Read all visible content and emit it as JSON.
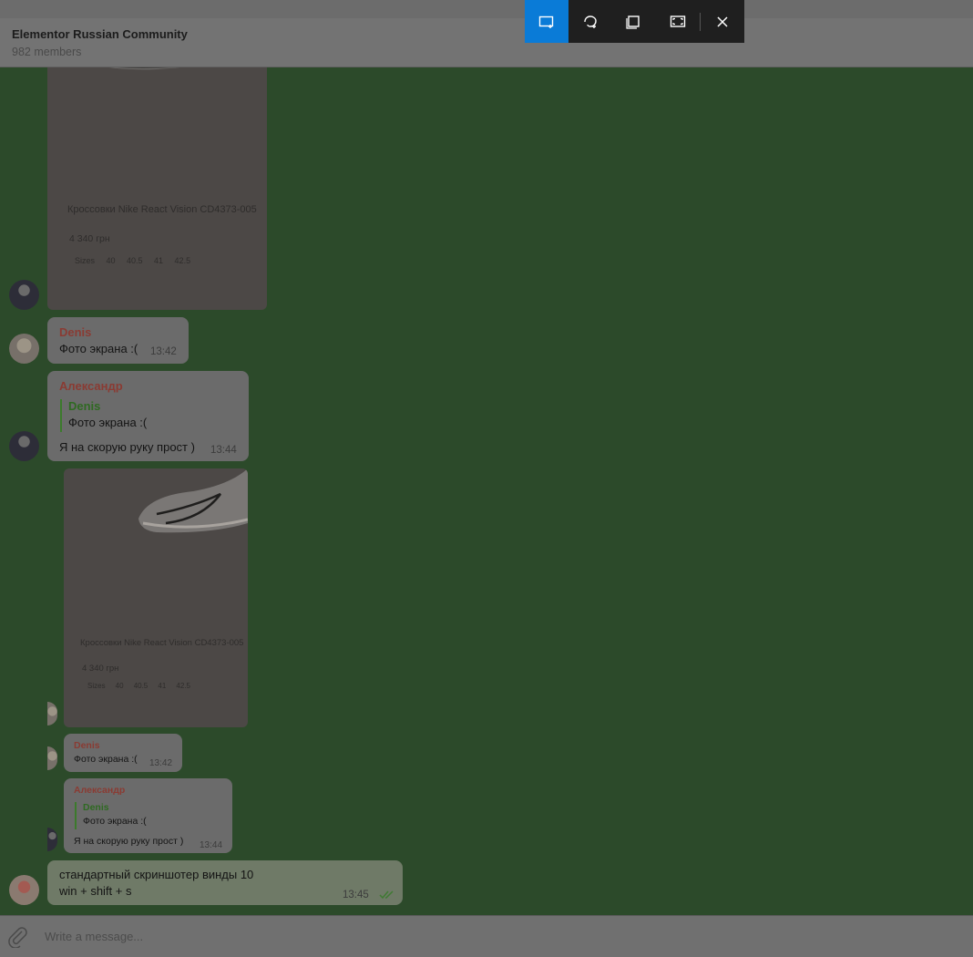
{
  "header": {
    "title": "Elementor Russian Community",
    "subtitle": "982 members"
  },
  "snip_toolbar": {
    "buttons": [
      {
        "icon": "rectangular-snip-icon",
        "active": true
      },
      {
        "icon": "freeform-snip-icon",
        "active": false
      },
      {
        "icon": "window-snip-icon",
        "active": false
      },
      {
        "icon": "fullscreen-snip-icon",
        "active": false
      },
      {
        "icon": "close-icon",
        "active": false
      }
    ]
  },
  "messages": {
    "photo1": {
      "caption": "Кроссовки Nike React Vision CD4373-005",
      "price": "4 340 грн",
      "sizes": "Sizes     40     40.5     41     42.5"
    },
    "m1": {
      "sender": "Denis",
      "text": "Фото экрана :(",
      "time": "13:42"
    },
    "m2": {
      "sender": "Александр",
      "quote_sender": "Denis",
      "quote_text": "Фото экрана :(",
      "text": "Я на скорую руку прост )",
      "time": "13:44"
    },
    "photo2": {
      "caption": "Кроссовки Nike React Vision CD4373-005",
      "price": "4 340 грн",
      "sizes": "Sizes     40     40.5     41     42.5"
    },
    "m3": {
      "sender": "Denis",
      "text": "Фото экрана :(",
      "time": "13:42"
    },
    "m4": {
      "sender": "Александр",
      "quote_sender": "Denis",
      "quote_text": "Фото экрана :(",
      "text": "Я на скорую руку прост )",
      "time": "13:44"
    },
    "m5": {
      "line1": "стандартный скриншотер винды 10",
      "line2": "win + shift + s",
      "time": "13:45"
    }
  },
  "composer": {
    "placeholder": "Write a message..."
  }
}
